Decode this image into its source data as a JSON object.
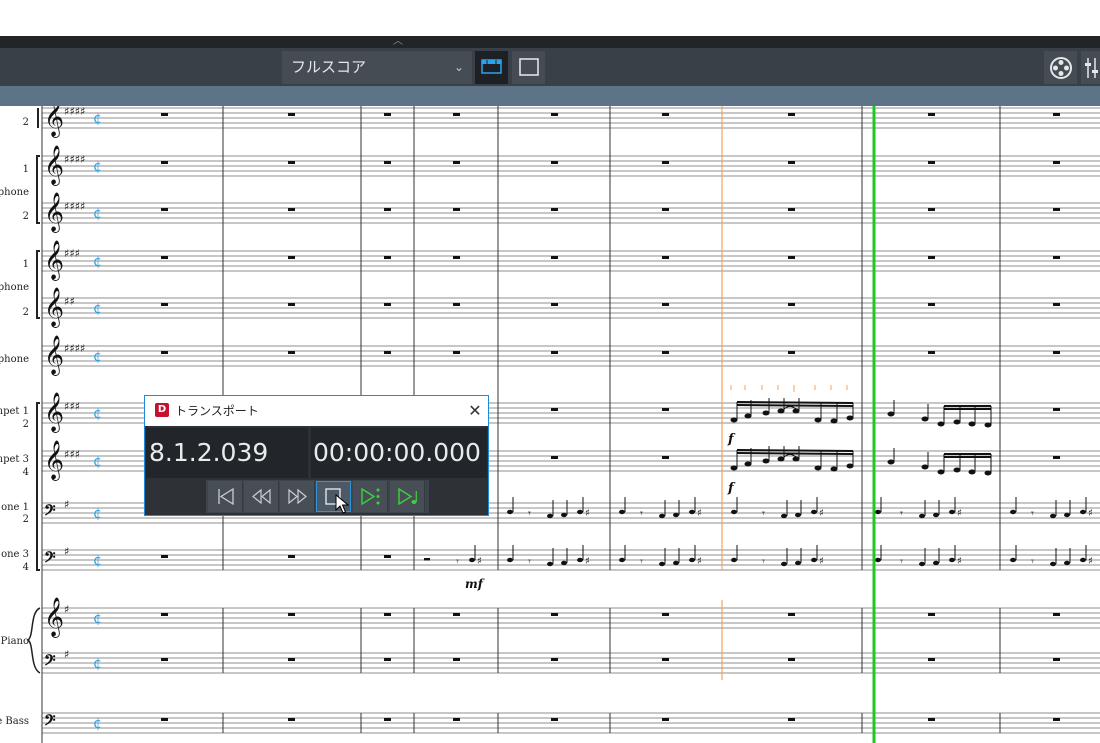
{
  "toolbar": {
    "layout_select": {
      "value": "フルスコア"
    }
  },
  "colors": {
    "toolbar_bg": "#3a4047",
    "subbar_bg": "#5d7488",
    "accent_blue": "#2aa5ec",
    "playhead_green": "#1fc81f",
    "marker_orange": "#f5a35a",
    "transport_bg": "#2e3237"
  },
  "score": {
    "staves": [
      {
        "label": "2",
        "clef": "treble"
      },
      {
        "label": "1",
        "clef": "treble"
      },
      {
        "label": "phone",
        "clef": "treble"
      },
      {
        "label": "2",
        "clef": "treble"
      },
      {
        "label": "1",
        "clef": "treble"
      },
      {
        "label": "phone",
        "clef": "treble"
      },
      {
        "label": "2",
        "clef": "treble"
      },
      {
        "label": "phone",
        "clef": "treble"
      },
      {
        "label": "mpet 1",
        "clef": "treble"
      },
      {
        "label": "2",
        "clef": "treble"
      },
      {
        "label": "mpet 3",
        "clef": "treble"
      },
      {
        "label": "4",
        "clef": "treble"
      },
      {
        "label": "one 1",
        "clef": "bass"
      },
      {
        "label": "2",
        "clef": "bass"
      },
      {
        "label": "one 3",
        "clef": "bass"
      },
      {
        "label": "4",
        "clef": "bass"
      },
      {
        "label": "Piano",
        "clef": "grand"
      },
      {
        "label": "e Bass",
        "clef": "bass"
      }
    ],
    "dynamics": [
      "mf",
      "mf",
      "f",
      "f"
    ]
  },
  "transport": {
    "title": "トランスポート",
    "bars_beats": "8.1.2.039",
    "timecode": "00:00:00.000",
    "buttons": [
      "rewind-to-start",
      "rewind",
      "fast-forward",
      "stop",
      "play-from-selection",
      "play"
    ]
  }
}
